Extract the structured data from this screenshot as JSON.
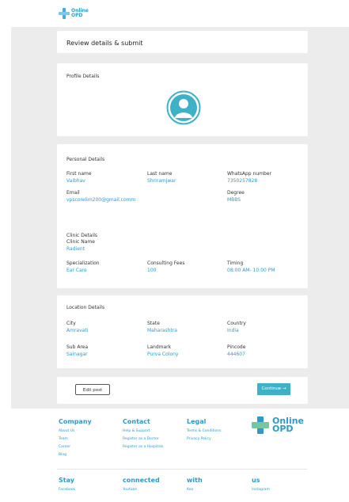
{
  "brand": {
    "line1": "Online",
    "line2": "OPD"
  },
  "review": {
    "title": "Review details & submit"
  },
  "profile": {
    "title": "Profile Details",
    "avatar_icon": "user-avatar-icon"
  },
  "personal": {
    "title": "Personal Details",
    "first_name": {
      "label": "First name",
      "value": "Vaibhav"
    },
    "last_name": {
      "label": "Last name",
      "value": "Shriramjwar"
    },
    "whatsapp": {
      "label": "WhatsApp number",
      "value": "7350257828"
    },
    "email": {
      "label": "Email",
      "value": "vpscorelim200@gmail.comm"
    },
    "degree": {
      "label": "Degree",
      "value": "MBBS"
    }
  },
  "clinic": {
    "title": "Clinic Details",
    "name": {
      "label": "Clinic Name",
      "value": "Radient"
    },
    "specialization": {
      "label": "Specialization",
      "value": "Ear Care"
    },
    "fees": {
      "label": "Consulting Fees",
      "value": "100"
    },
    "timing": {
      "label": "Timing",
      "value": "08:00 AM- 10:00 PM"
    }
  },
  "location": {
    "title": "Location Details",
    "city": {
      "label": "City",
      "value": "Amravati"
    },
    "state": {
      "label": "State",
      "value": "Maharashtra"
    },
    "country": {
      "label": "Country",
      "value": "India"
    },
    "subarea": {
      "label": "Sub Area",
      "value": "Sainagar"
    },
    "landmark": {
      "label": "Landmark",
      "value": "Purva Colony"
    },
    "pincode": {
      "label": "Pincode",
      "value": "444607"
    }
  },
  "actions": {
    "edit": "Edit post",
    "continue": "Continue →"
  },
  "footer": {
    "company": {
      "title": "Company",
      "links": [
        "About Us",
        "Team",
        "Career",
        "Blog"
      ]
    },
    "contact": {
      "title": "Contact",
      "links": [
        "Help & Support",
        "Register as a Doctor",
        "Register as a Hospitals"
      ]
    },
    "legal": {
      "title": "Legal",
      "links": [
        "Terms & Conditions",
        "Privacy Policy"
      ]
    },
    "social": [
      {
        "title": "Stay",
        "link": "Facebook"
      },
      {
        "title": "connected",
        "link": "Youtube"
      },
      {
        "title": "with",
        "link": "Koo"
      },
      {
        "title": "us",
        "link": "Instagram"
      }
    ]
  },
  "colors": {
    "accent": "#2f9ac9",
    "button": "#3fb1c7",
    "avatar": "#3fb1c7",
    "background": "#ececec"
  }
}
